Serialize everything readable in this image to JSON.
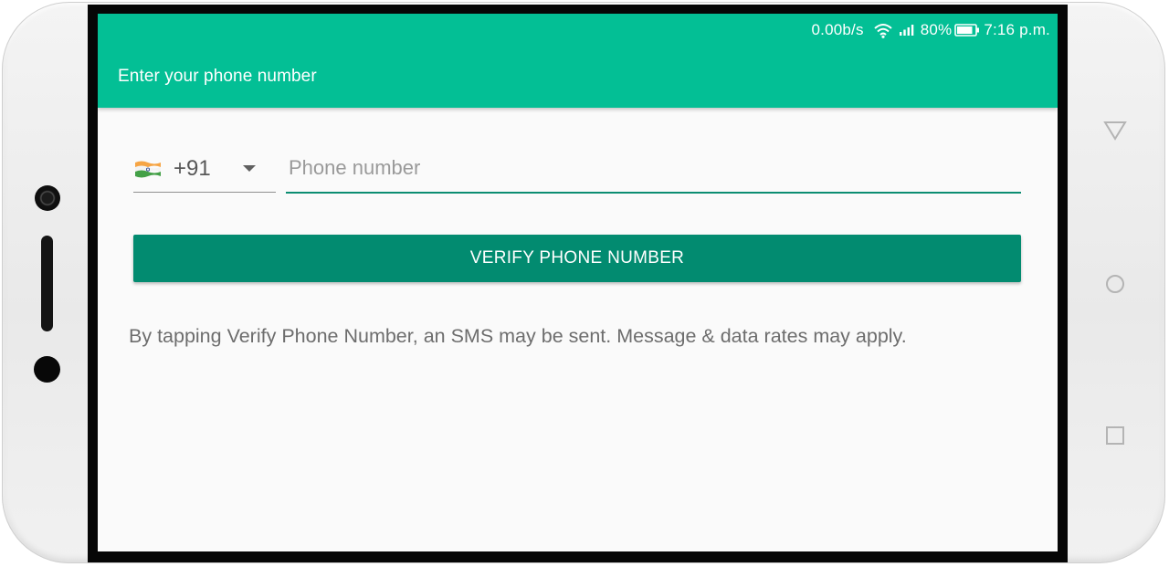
{
  "status_bar": {
    "network_speed": "0.00b/s",
    "battery_percent": "80%",
    "time": "7:16 p.m."
  },
  "app_bar": {
    "title": "Enter your phone number"
  },
  "form": {
    "country_code": "+91",
    "phone_placeholder": "Phone number",
    "verify_button_label": "VERIFY PHONE NUMBER",
    "disclaimer": "By tapping Verify Phone Number, an SMS may be sent. Message & data rates may apply."
  },
  "icons": {
    "flag": "india-flag-icon",
    "dropdown": "arrow-drop-down-icon",
    "wifi": "wifi-icon",
    "signal": "cellular-signal-icon",
    "battery": "battery-icon",
    "nav_back": "nav-back-icon",
    "nav_home": "nav-home-icon",
    "nav_recent": "nav-recent-apps-icon"
  },
  "colors": {
    "app_bar": "#03bf95",
    "button": "#028b70",
    "input_underline": "#0c8d72",
    "screen_background": "#fafafa"
  }
}
